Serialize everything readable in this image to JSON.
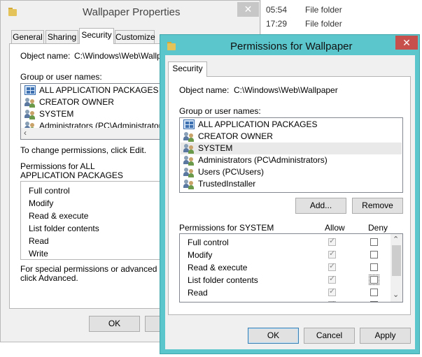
{
  "background_explorer": {
    "rows": [
      {
        "time": "05:54",
        "type": "File folder"
      },
      {
        "time": "17:29",
        "type": "File folder"
      }
    ]
  },
  "properties_window": {
    "title": "Wallpaper Properties",
    "close_glyph": "✕",
    "tabs": [
      "General",
      "Sharing",
      "Security",
      "Customize"
    ],
    "active_tab": "Security",
    "object_name_label": "Object name:",
    "object_name_value": "C:\\Windows\\Web\\Wallpa",
    "group_label": "Group or user names:",
    "groups": [
      "ALL APPLICATION PACKAGES",
      "CREATOR OWNER",
      "SYSTEM",
      "Administrators (PC\\Administrators)"
    ],
    "change_hint": "To change permissions, click Edit.",
    "permissions_for_line1": "Permissions for ALL",
    "permissions_for_line2": "APPLICATION PACKAGES",
    "permissions": [
      "Full control",
      "Modify",
      "Read & execute",
      "List folder contents",
      "Read",
      "Write"
    ],
    "special_hint_line1": "For special permissions or advanced settin",
    "special_hint_line2": "click Advanced.",
    "ok_label": "OK"
  },
  "permissions_window": {
    "title": "Permissions for Wallpaper",
    "close_glyph": "✕",
    "tab": "Security",
    "object_name_label": "Object name:",
    "object_name_value": "C:\\Windows\\Web\\Wallpaper",
    "group_label": "Group or user names:",
    "groups": [
      {
        "name": "ALL APPLICATION PACKAGES",
        "icon": "packages-icon"
      },
      {
        "name": "CREATOR OWNER",
        "icon": "users-icon"
      },
      {
        "name": "SYSTEM",
        "icon": "users-icon",
        "selected": true
      },
      {
        "name": "Administrators (PC\\Administrators)",
        "icon": "users-icon"
      },
      {
        "name": "Users (PC\\Users)",
        "icon": "users-icon"
      },
      {
        "name": "TrustedInstaller",
        "icon": "users-icon"
      }
    ],
    "add_label": "Add...",
    "remove_label": "Remove",
    "permissions_for": "Permissions for SYSTEM",
    "allow_header": "Allow",
    "deny_header": "Deny",
    "permissions": [
      {
        "name": "Full control",
        "allow": true,
        "deny": false
      },
      {
        "name": "Modify",
        "allow": true,
        "deny": false
      },
      {
        "name": "Read & execute",
        "allow": true,
        "deny": false
      },
      {
        "name": "List folder contents",
        "allow": true,
        "deny": false
      },
      {
        "name": "Read",
        "allow": true,
        "deny": false
      }
    ],
    "ok_label": "OK",
    "cancel_label": "Cancel",
    "apply_label": "Apply",
    "scroll_up_glyph": "⌃",
    "scroll_down_glyph": "⌄"
  },
  "colors": {
    "accent_frame": "#5bc6cc",
    "close_button_active": "#c7504c",
    "close_button_inactive": "#c7c7c7"
  }
}
